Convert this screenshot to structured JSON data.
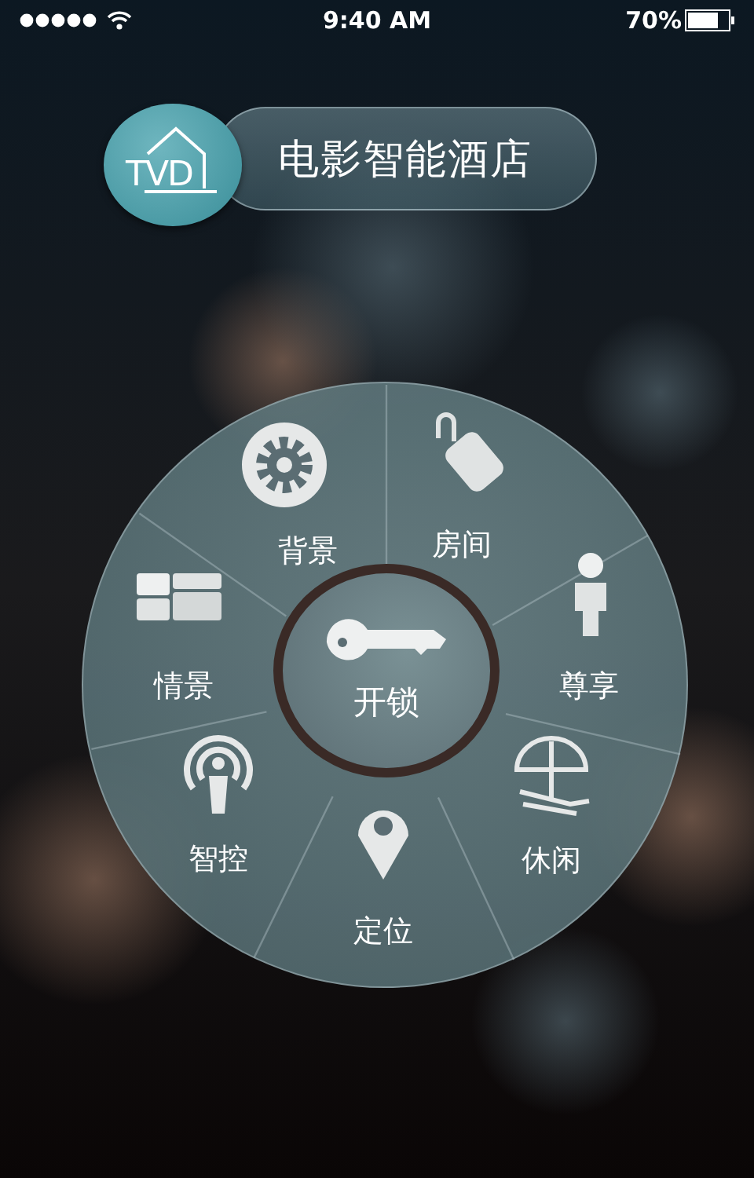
{
  "status_bar": {
    "time": "9:40 AM",
    "battery": "70%"
  },
  "header": {
    "logo_text": "TVD",
    "title": "电影智能酒店"
  },
  "wheel": {
    "center": {
      "kind": "key",
      "label": "开锁"
    },
    "items": [
      {
        "kind": "gear",
        "label": "背景"
      },
      {
        "kind": "tag",
        "label": "房间"
      },
      {
        "kind": "person",
        "label": "尊享"
      },
      {
        "kind": "umbrella",
        "label": "休闲"
      },
      {
        "kind": "pin",
        "label": "定位"
      },
      {
        "kind": "signal",
        "label": "智控"
      },
      {
        "kind": "panels",
        "label": "情景"
      }
    ]
  }
}
